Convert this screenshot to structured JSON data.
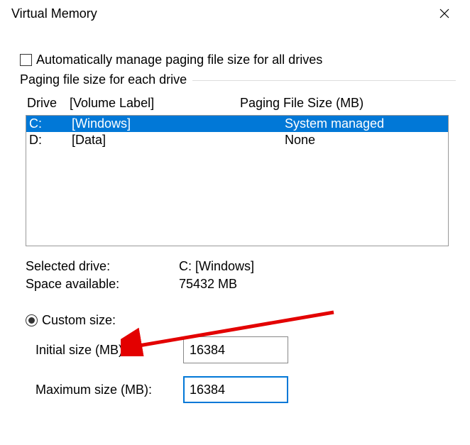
{
  "window": {
    "title": "Virtual Memory"
  },
  "auto_manage": {
    "checked": false,
    "label": "Automatically manage paging file size for all drives"
  },
  "fieldset": {
    "legend": "Paging file size for each drive",
    "headers": {
      "drive": "Drive",
      "label": "[Volume Label]",
      "size": "Paging File Size (MB)"
    },
    "rows": [
      {
        "drive": "C:",
        "label": "[Windows]",
        "size": "System managed",
        "selected": true
      },
      {
        "drive": "D:",
        "label": "[Data]",
        "size": "None",
        "selected": false
      }
    ]
  },
  "info": {
    "selected_drive_label": "Selected drive:",
    "selected_drive_value": "C:  [Windows]",
    "space_available_label": "Space available:",
    "space_available_value": "75432 MB"
  },
  "custom_size": {
    "radio_label": "Custom size:",
    "radio_selected": true,
    "initial_label": "Initial size (MB):",
    "initial_value": "16384",
    "maximum_label": "Maximum size (MB):",
    "maximum_value": "16384"
  }
}
